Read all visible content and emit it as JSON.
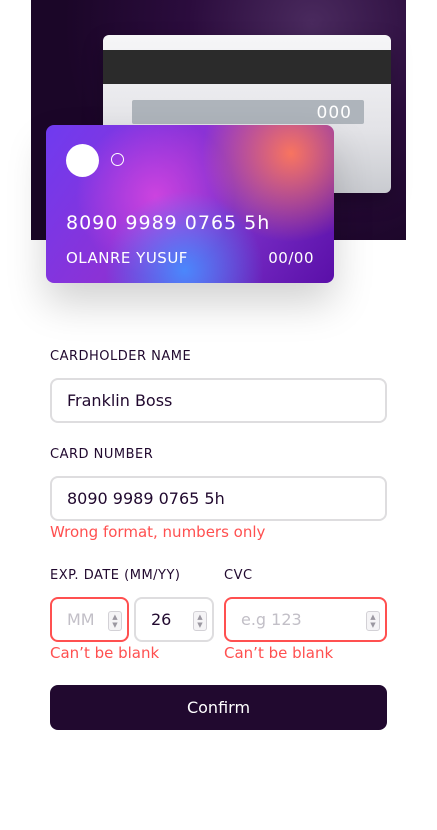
{
  "card_back": {
    "cvc": "000"
  },
  "card_front": {
    "number": "8090 9989 0765 5h",
    "name": "OLANRE YUSUF",
    "expiry": "00/00"
  },
  "form": {
    "cardholder": {
      "label": "CARDHOLDER NAME",
      "value": "Franklin Boss"
    },
    "card_number": {
      "label": "CARD NUMBER",
      "value": "8090 9989 0765 5h",
      "error": "Wrong format, numbers only"
    },
    "exp": {
      "label": "EXP. DATE (MM/YY)",
      "month_placeholder": "MM",
      "month_value": "",
      "year_value": "26",
      "error": "Can’t be blank"
    },
    "cvc": {
      "label": "CVC",
      "placeholder": "e.g 123",
      "value": "",
      "error": "Can’t be blank"
    },
    "confirm_label": "Confirm"
  },
  "colors": {
    "accent": "#21092f",
    "error": "#ff5050",
    "border": "#dedddf"
  }
}
